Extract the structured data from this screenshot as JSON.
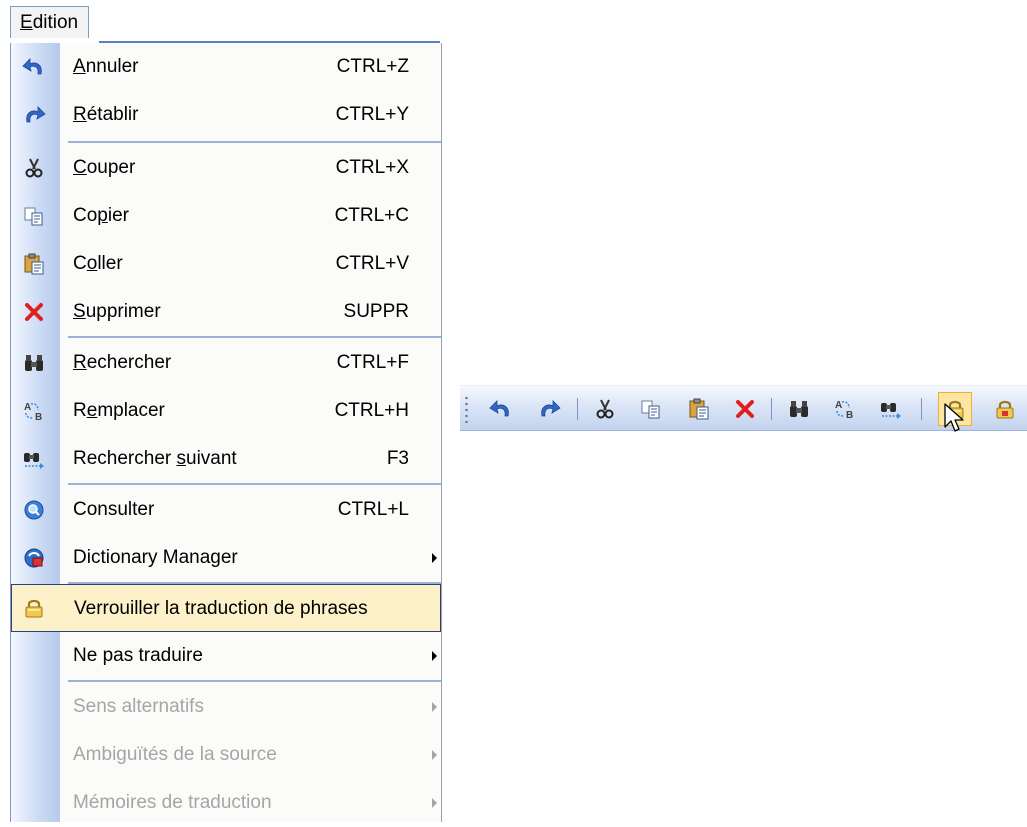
{
  "menu": {
    "title_accel": "E",
    "title_rest": "dition"
  },
  "items": {
    "annuler": {
      "label_pre": "",
      "label_accel": "A",
      "label_post": "nnuler",
      "shortcut": "CTRL+Z"
    },
    "retablir": {
      "label_pre": "",
      "label_accel": "R",
      "label_post": "établir",
      "shortcut": "CTRL+Y"
    },
    "couper": {
      "label_pre": "",
      "label_accel": "C",
      "label_post": "ouper",
      "shortcut": "CTRL+X"
    },
    "copier": {
      "label_pre": "Co",
      "label_accel": "p",
      "label_post": "ier",
      "shortcut": "CTRL+C"
    },
    "coller": {
      "label_pre": "C",
      "label_accel": "o",
      "label_post": "ller",
      "shortcut": "CTRL+V"
    },
    "supprimer": {
      "label_pre": "",
      "label_accel": "S",
      "label_post": "upprimer",
      "shortcut": "SUPPR"
    },
    "rechercher": {
      "label_pre": "",
      "label_accel": "R",
      "label_post": "echercher",
      "shortcut": "CTRL+F"
    },
    "remplacer": {
      "label_pre": "R",
      "label_accel": "e",
      "label_post": "mplacer",
      "shortcut": "CTRL+H"
    },
    "rechercher_suivant": {
      "label_pre": "Rechercher ",
      "label_accel": "s",
      "label_post": "uivant",
      "shortcut": "F3"
    },
    "consulter": {
      "label": "Consulter",
      "shortcut": "CTRL+L"
    },
    "dictionary_manager": {
      "label": "Dictionary Manager"
    },
    "verrouiller": {
      "label": "Verrouiller la traduction de phrases"
    },
    "ne_pas_traduire": {
      "label": "Ne pas traduire"
    },
    "sens_alternatifs": {
      "label": "Sens alternatifs"
    },
    "ambiguites": {
      "label": "Ambiguïtés de la source"
    },
    "memoires": {
      "label": "Mémoires de traduction"
    }
  },
  "colors": {
    "highlight_bg": "#fdf1c9",
    "highlight_border": "#2e3f7a",
    "disabled_text": "#a5a5a5",
    "delete_red": "#e02020"
  },
  "toolbar": {
    "buttons": [
      "undo-icon",
      "redo-icon",
      "cut-icon",
      "copy-icon",
      "paste-icon",
      "delete-icon",
      "find-icon",
      "replace-icon",
      "find-next-icon",
      "lock-icon",
      "lock-red-icon"
    ],
    "active_button": "lock-icon"
  }
}
